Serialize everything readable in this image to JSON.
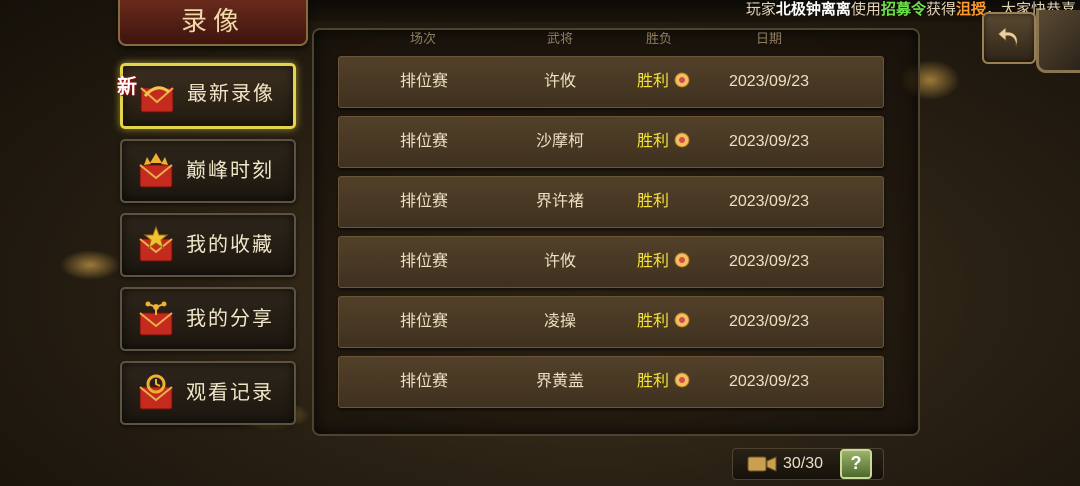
{
  "marquee": {
    "prefix": "玩家",
    "player": "北极钟离离",
    "mid1": "使用",
    "item": "招募令",
    "mid2": "获得",
    "hero": "沮授",
    "suffix": "，大家快恭喜"
  },
  "title": "录像",
  "back_icon": "back-arrow-icon",
  "sidebar": {
    "new_badge": "新",
    "items": [
      {
        "label": "最新录像",
        "icon": "envelope-ribbon-icon",
        "active": true
      },
      {
        "label": "巅峰时刻",
        "icon": "envelope-arrows-icon",
        "active": false
      },
      {
        "label": "我的收藏",
        "icon": "envelope-star-icon",
        "active": false
      },
      {
        "label": "我的分享",
        "icon": "envelope-share-icon",
        "active": false
      },
      {
        "label": "观看记录",
        "icon": "envelope-history-icon",
        "active": false
      }
    ]
  },
  "columns": {
    "mode": "场次",
    "general": "武将",
    "result": "胜负",
    "date": "日期"
  },
  "rows": [
    {
      "mode": "排位赛",
      "general": "许攸",
      "result": "胜利",
      "medal": true,
      "date": "2023/09/23"
    },
    {
      "mode": "排位赛",
      "general": "沙摩柯",
      "result": "胜利",
      "medal": true,
      "date": "2023/09/23"
    },
    {
      "mode": "排位赛",
      "general": "界许褚",
      "result": "胜利",
      "medal": false,
      "date": "2023/09/23"
    },
    {
      "mode": "排位赛",
      "general": "许攸",
      "result": "胜利",
      "medal": true,
      "date": "2023/09/23"
    },
    {
      "mode": "排位赛",
      "general": "凌操",
      "result": "胜利",
      "medal": true,
      "date": "2023/09/23"
    },
    {
      "mode": "排位赛",
      "general": "界黄盖",
      "result": "胜利",
      "medal": true,
      "date": "2023/09/23"
    }
  ],
  "footer": {
    "count": "30/30",
    "help": "?",
    "icon": "video-camera-icon"
  },
  "colors": {
    "accent": "#e3d44a",
    "win": "#f4e23a",
    "item_green": "#6ee04a",
    "hero_orange": "#ff9a2e"
  }
}
